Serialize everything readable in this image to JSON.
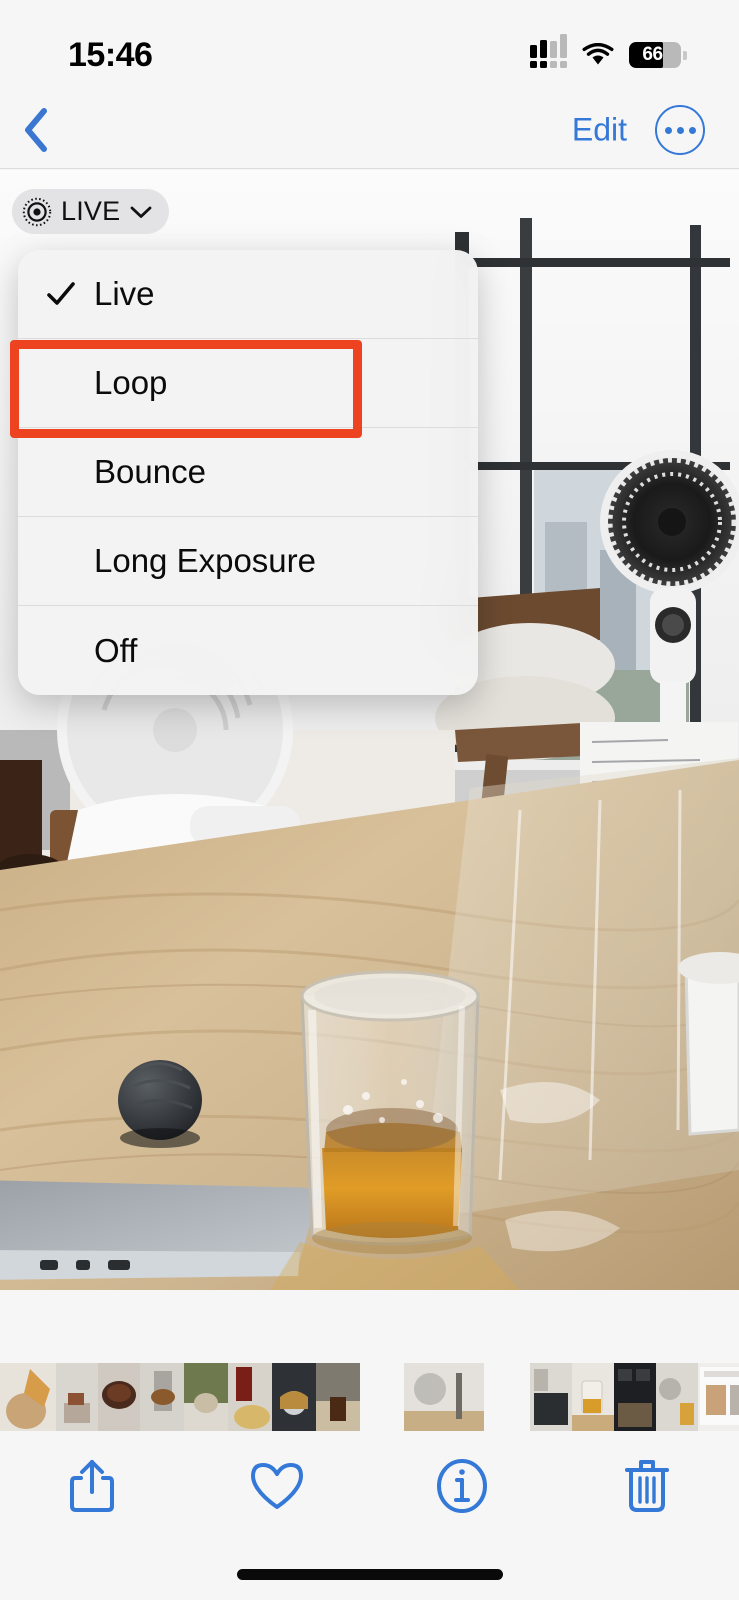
{
  "status_bar": {
    "time": "15:46",
    "cellular_icon": "cellular-dots-icon",
    "wifi_icon": "wifi-icon",
    "battery_icon": "battery-icon",
    "battery_percent": "66"
  },
  "nav_bar": {
    "back_icon": "chevron-left-icon",
    "edit_label": "Edit",
    "more_icon": "ellipsis-circle-icon"
  },
  "live_badge": {
    "icon": "live-photo-icon",
    "label": "LIVE",
    "chevron_icon": "chevron-down-icon"
  },
  "menu": {
    "items": [
      {
        "label": "Live",
        "checked": true,
        "icon": "checkmark-icon"
      },
      {
        "label": "Loop",
        "checked": false,
        "icon": ""
      },
      {
        "label": "Bounce",
        "checked": false,
        "icon": ""
      },
      {
        "label": "Long Exposure",
        "checked": false,
        "icon": ""
      },
      {
        "label": "Off",
        "checked": false,
        "icon": ""
      }
    ],
    "highlighted_item": "Loop",
    "highlight_color": "#ee4320"
  },
  "toolbar": {
    "share_icon": "share-icon",
    "favorite_icon": "heart-icon",
    "info_icon": "info-circle-icon",
    "delete_icon": "trash-icon",
    "accent_color": "#3478d8"
  },
  "filmstrip": {
    "label": "photo-thumbnail-strip"
  },
  "home_indicator": {
    "label": "home-indicator"
  }
}
